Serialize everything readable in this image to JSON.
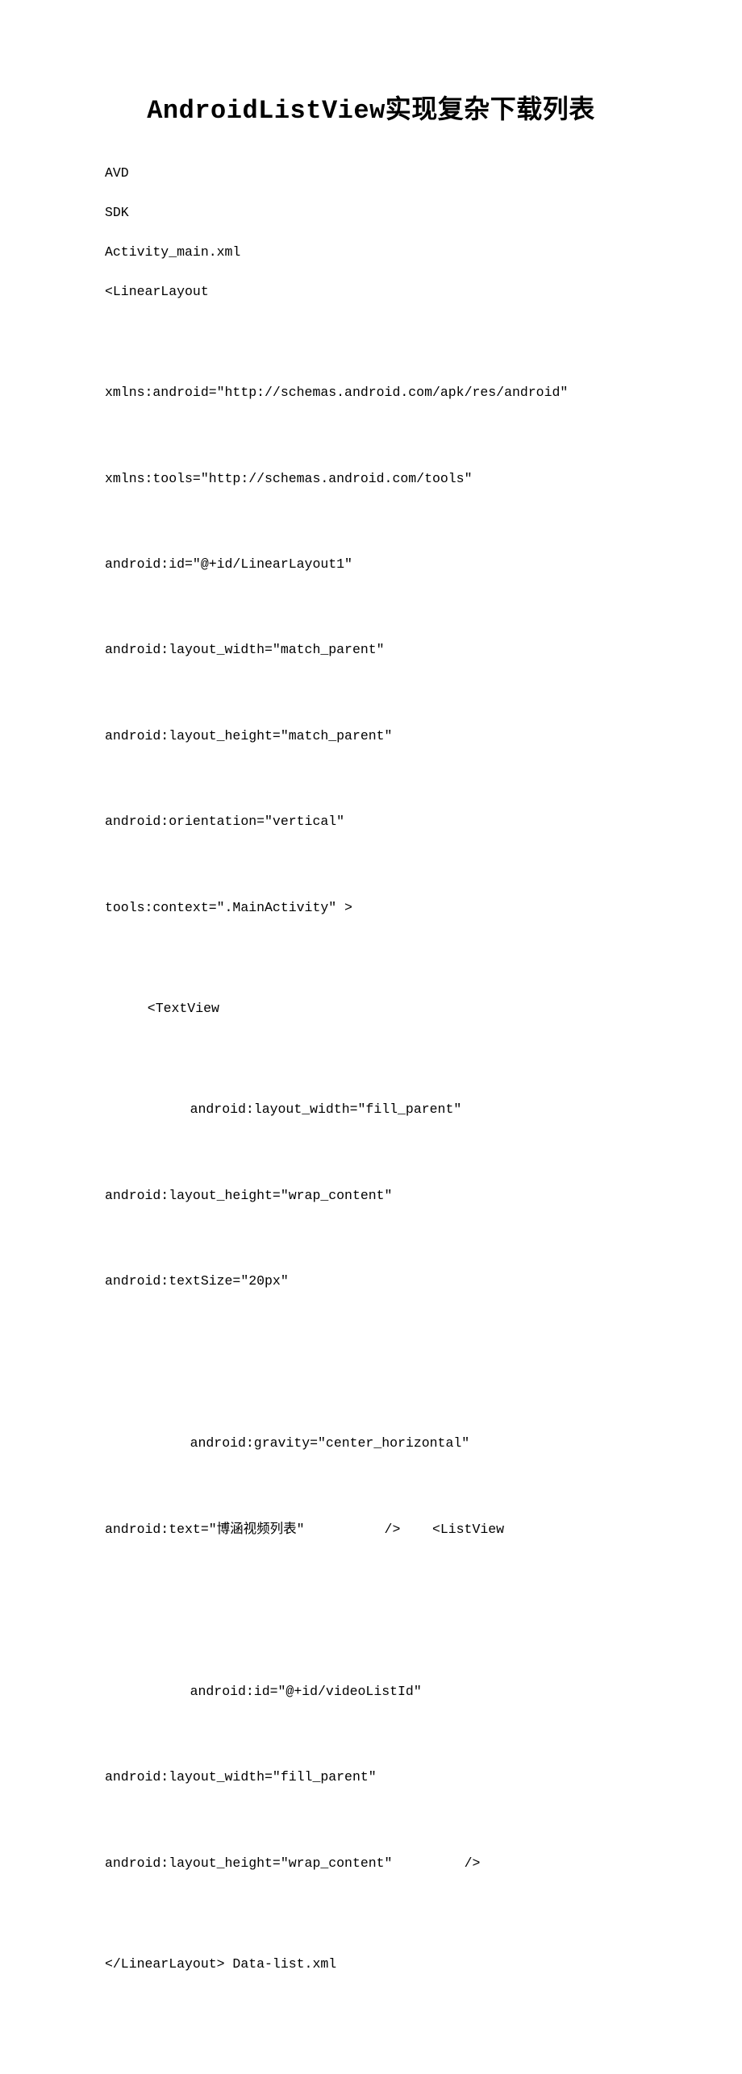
{
  "title": "AndroidListView实现复杂下载列表",
  "lines": {
    "l1": "AVD",
    "l2": "SDK",
    "l3": "Activity_main.xml",
    "l4": "<LinearLayout",
    "b1_1": "xmlns:android=\"http://schemas.android.com/apk/res/android\"",
    "b1_2": "xmlns:tools=\"http://schemas.android.com/tools\"",
    "b1_3": "android:id=\"@+id/LinearLayout1\"",
    "b1_4": "android:layout_width=\"match_parent\"",
    "b1_5": "android:layout_height=\"match_parent\"",
    "b1_6": "android:orientation=\"vertical\"",
    "b1_7": "tools:context=\".MainActivity\" >",
    "l5": "<TextView",
    "b2_1": "android:layout_width=\"fill_parent\"",
    "b2_2": "android:layout_height=\"wrap_content\"",
    "b2_3": "android:textSize=\"20px\"",
    "b3_1": "android:gravity=\"center_horizontal\"",
    "b3_2": "android:text=\"博涵视频列表\"          />    <ListView",
    "b4_1": "android:id=\"@+id/videoListId\"",
    "b4_2": "android:layout_width=\"fill_parent\"",
    "b4_3": "android:layout_height=\"wrap_content\"         />",
    "l6": "</LinearLayout> Data-list.xml"
  }
}
